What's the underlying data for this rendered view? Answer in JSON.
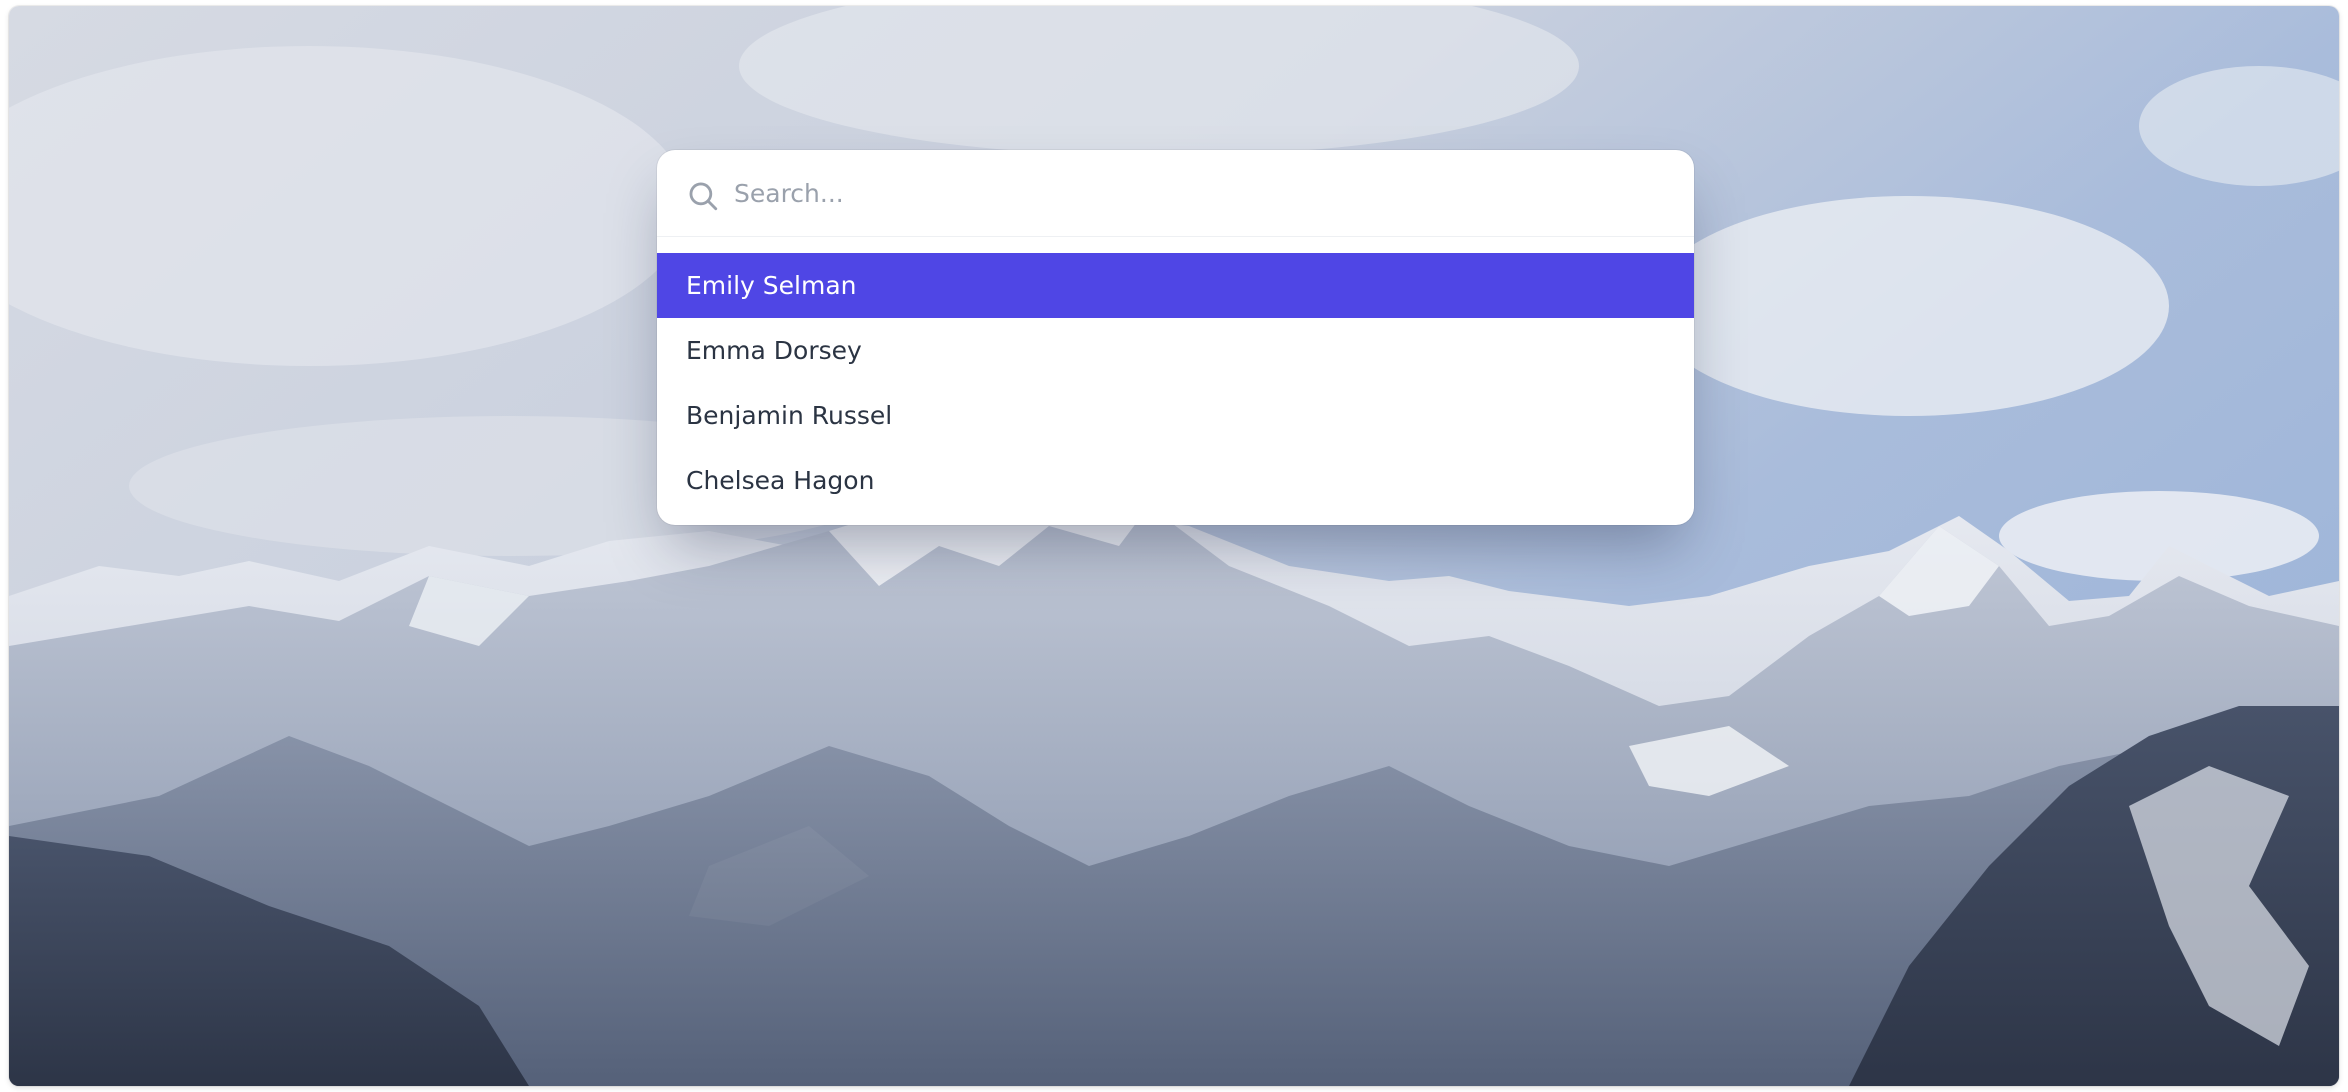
{
  "search": {
    "placeholder": "Search...",
    "value": ""
  },
  "results": [
    {
      "name": "Emily Selman",
      "active": true
    },
    {
      "name": "Emma Dorsey",
      "active": false
    },
    {
      "name": "Benjamin Russel",
      "active": false
    },
    {
      "name": "Chelsea Hagon",
      "active": false
    }
  ],
  "colors": {
    "accent": "#4f46e5",
    "text": "#2b3443",
    "placeholder": "#9aa1ac"
  },
  "icons": {
    "search": "search-icon"
  }
}
